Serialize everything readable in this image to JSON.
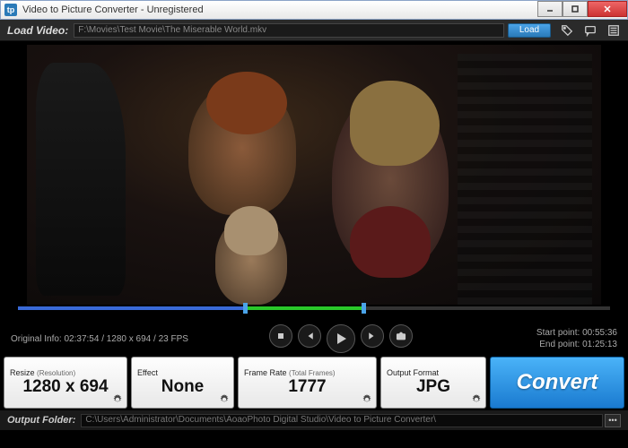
{
  "window": {
    "title": "Video to Picture Converter - Unregistered"
  },
  "loadbar": {
    "label": "Load Video:",
    "path": "F:\\Movies\\Test Movie\\The Miserable World.mkv",
    "button": "Load"
  },
  "timeline": {
    "played_pct": 38,
    "range_start_pct": 38,
    "range_end_pct": 58
  },
  "info": {
    "original_prefix": "Original Info: ",
    "original": "02:37:54 / 1280 x 694 / 23 FPS",
    "start_label": "Start point: ",
    "start": "00:55:36",
    "end_label": "End point: ",
    "end": "01:25:13"
  },
  "panels": {
    "resize": {
      "title": "Resize",
      "subtitle": "(Resolution)",
      "value": "1280 x 694"
    },
    "effect": {
      "title": "Effect",
      "value": "None"
    },
    "framerate": {
      "title": "Frame Rate",
      "subtitle": "(Total Frames)",
      "value": "1777"
    },
    "output": {
      "title": "Output Format",
      "value": "JPG"
    },
    "convert": "Convert"
  },
  "outbar": {
    "label": "Output Folder:",
    "path": "C:\\Users\\Administrator\\Documents\\AoaoPhoto Digital Studio\\Video to Picture Converter\\",
    "browse": "•••"
  }
}
